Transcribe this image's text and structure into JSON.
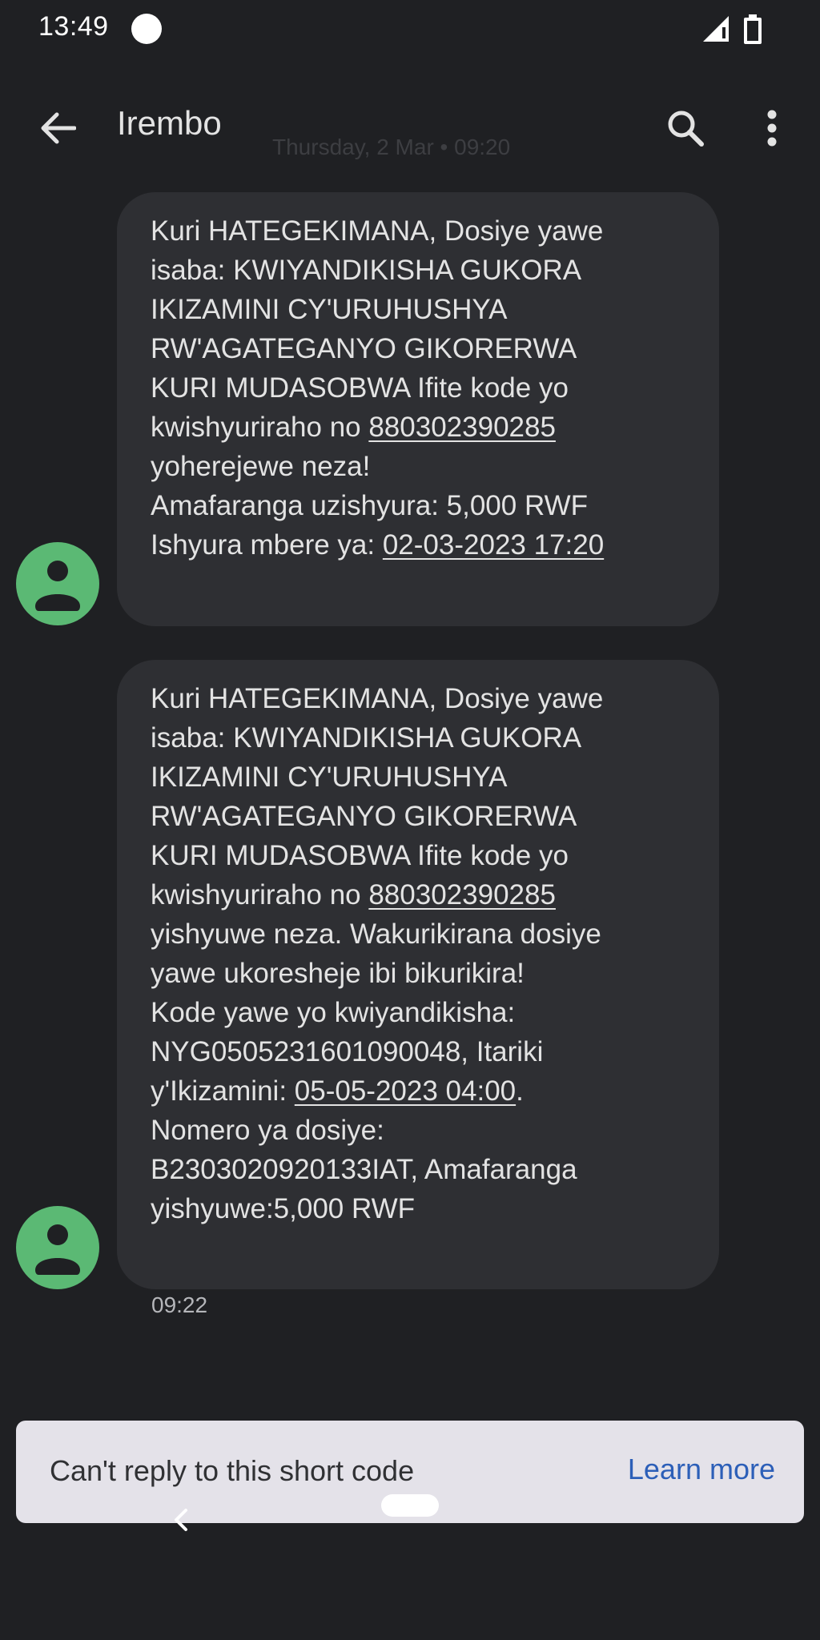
{
  "status_bar": {
    "time": "13:49",
    "icons": [
      "notification-dot-icon",
      "signal-icon",
      "battery-icon"
    ]
  },
  "app_bar": {
    "title": "Irembo",
    "date_header": "Thursday, 2 Mar • 09:20",
    "icons": [
      "back-arrow-icon",
      "search-icon",
      "more-vert-icon"
    ]
  },
  "messages": [
    {
      "lines": [
        "Kuri HATEGEKIMANA, Dosiye yawe",
        "isaba: KWIYANDIKISHA GUKORA",
        "IKIZAMINI CY'URUHUSHYA",
        "RW'AGATEGANYO GIKORERWA",
        "KURI MUDASOBWA Ifite kode yo"
      ],
      "code_prefix": "kwishyuriraho no ",
      "code": "880302390285",
      "after_code": "yoherejewe neza!",
      "amount_line": "Amafaranga uzishyura: 5,000 RWF",
      "deadline_prefix": "Ishyura mbere ya: ",
      "deadline": "02-03-2023 17:20"
    },
    {
      "lines": [
        "Kuri HATEGEKIMANA, Dosiye yawe",
        "isaba: KWIYANDIKISHA GUKORA",
        "IKIZAMINI CY'URUHUSHYA",
        "RW'AGATEGANYO GIKORERWA",
        "KURI MUDASOBWA Ifite kode yo"
      ],
      "code_prefix": "kwishyuriraho no ",
      "code": "880302390285",
      "after_lines": [
        "yishyuwe neza. Wakurikirana dosiye",
        "yawe ukoresheje ibi bikurikira!",
        "Kode yawe yo kwiyandikisha:",
        "NYG0505231601090048, Itariki"
      ],
      "exam_date_prefix": "y'Ikizamini: ",
      "exam_date": "05-05-2023 04:00",
      "exam_date_suffix": ".",
      "tail_lines": [
        "Nomero ya dosiye:",
        "B2303020920133IAT, Amafaranga",
        "yishyuwe:5,000 RWF"
      ],
      "time": "09:22"
    }
  ],
  "reply_banner": {
    "text": "Can't reply to this short code",
    "link": "Learn more"
  },
  "colors": {
    "background": "#1f2023",
    "bubble": "#2e2f33",
    "avatar": "#5bb974",
    "banner": "#e4e2e9",
    "link": "#2c5fb8"
  }
}
